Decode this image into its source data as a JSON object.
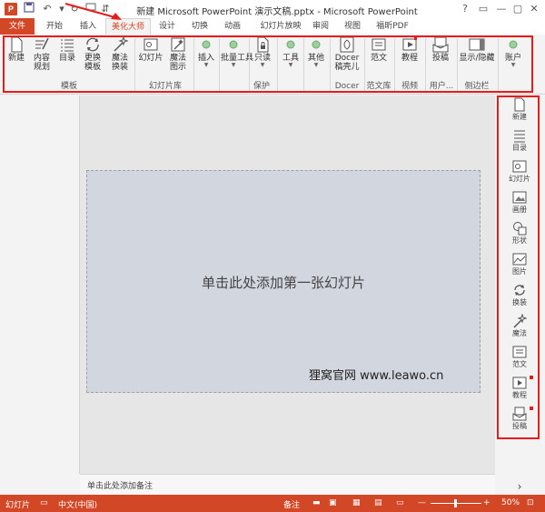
{
  "window": {
    "title": "新建 Microsoft PowerPoint 演示文稿.pptx - Microsoft PowerPoint",
    "app_badge": "P"
  },
  "quick_access": [
    "save-icon",
    "undo-icon",
    "redo-icon",
    "start-icon"
  ],
  "window_controls": [
    "?",
    "▭",
    "—",
    "▢",
    "✕"
  ],
  "tabs": [
    {
      "label": "文件"
    },
    {
      "label": "开始"
    },
    {
      "label": "插入"
    },
    {
      "label": "美化大师"
    },
    {
      "label": "设计"
    },
    {
      "label": "切换"
    },
    {
      "label": "动画"
    },
    {
      "label": "幻灯片放映"
    },
    {
      "label": "审阅"
    },
    {
      "label": "视图"
    },
    {
      "label": "福昕PDF"
    }
  ],
  "ribbon": {
    "buttons": {
      "new": "新建",
      "content_plan": "内容规划",
      "toc": "目录",
      "change_template": "更换模板",
      "magic_change": "魔法换装",
      "slides": "幻灯片",
      "magic_diagram": "魔法图示",
      "insert": "插入",
      "batch_tools": "批量工具",
      "read_only": "只读",
      "tools": "工具",
      "other": "其他",
      "docer_shell": "Docer稿壳儿",
      "sample_text": "范文",
      "tutorial": "教程",
      "submit": "投稿",
      "show_hide": "显示/隐藏",
      "account": "账户"
    },
    "groups": {
      "template": "模板",
      "slide_library": "幻灯片库",
      "protect": "保护",
      "docer": "Docer",
      "sample_library": "范文库",
      "video": "视频",
      "user": "用户...",
      "sidebar": "侧边栏"
    }
  },
  "slide": {
    "placeholder": "单击此处添加第一张幻灯片",
    "watermark": "狸窝官网  www.leawo.cn"
  },
  "notes": {
    "placeholder": "单击此处添加备注"
  },
  "sidebar": {
    "items": [
      {
        "label": "新建",
        "icon": "new-doc-icon"
      },
      {
        "label": "目录",
        "icon": "list-icon"
      },
      {
        "label": "幻灯片",
        "icon": "slides-icon"
      },
      {
        "label": "画册",
        "icon": "album-icon"
      },
      {
        "label": "形状",
        "icon": "shapes-icon"
      },
      {
        "label": "图片",
        "icon": "picture-icon"
      },
      {
        "label": "换装",
        "icon": "refresh-icon"
      },
      {
        "label": "魔法",
        "icon": "magic-wand-icon"
      },
      {
        "label": "范文",
        "icon": "document-icon"
      },
      {
        "label": "教程",
        "icon": "video-icon"
      },
      {
        "label": "投稿",
        "icon": "submit-icon"
      }
    ],
    "expand": "›"
  },
  "statusbar": {
    "slide_label": "幻灯片",
    "language": "中文(中国)",
    "notes": "备注",
    "comments": "批注",
    "zoom": "50%"
  },
  "colors": {
    "accent": "#d24726",
    "annotation": "#e81b1b"
  }
}
